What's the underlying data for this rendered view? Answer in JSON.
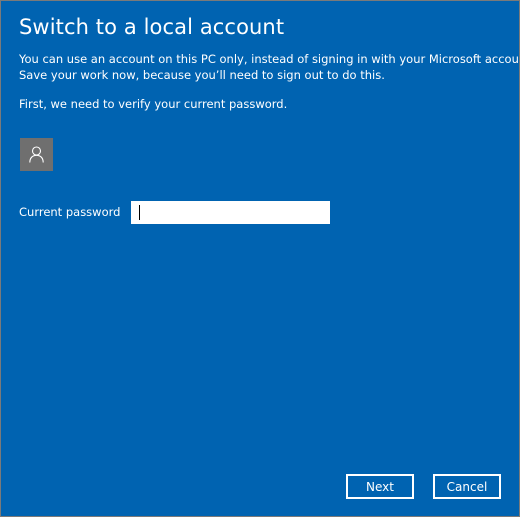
{
  "dialog": {
    "title": "Switch to a local account",
    "description_line1": "You can use an account on this PC only, instead of signing in with your Microsoft account.",
    "description_line2": "Save your work now, because you’ll need to sign out to do this.",
    "verify_text": "First, we need to verify your current password.",
    "avatar_icon": "user-icon"
  },
  "password": {
    "label": "Current password",
    "value": "",
    "placeholder": ""
  },
  "buttons": {
    "next_label": "Next",
    "cancel_label": "Cancel"
  },
  "colors": {
    "background": "#0063b1",
    "avatar_bg": "#6f6f6f",
    "text": "#ffffff"
  }
}
